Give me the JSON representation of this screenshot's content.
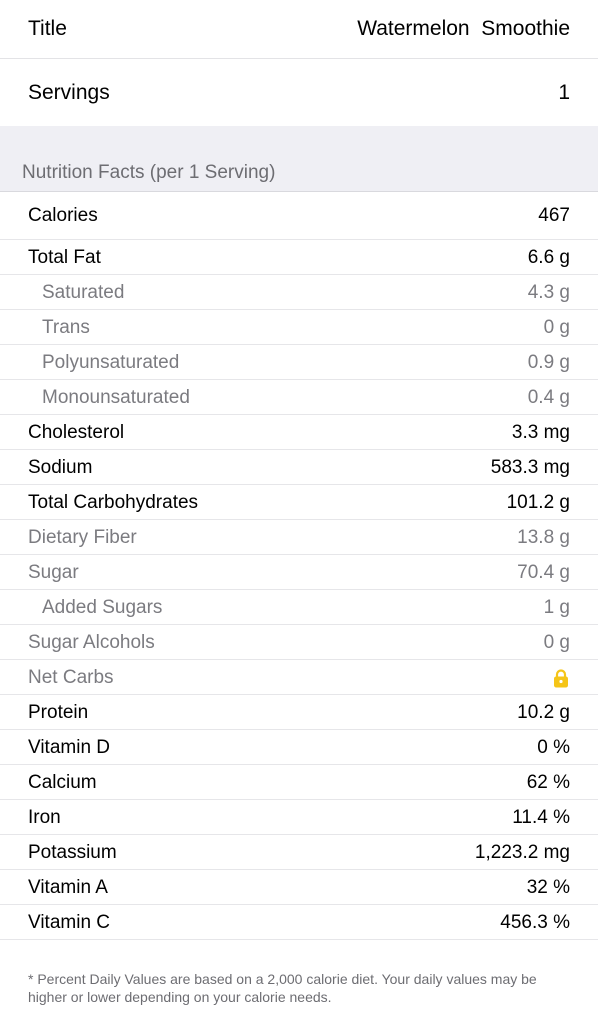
{
  "header": {
    "title_label": "Title",
    "title_value": "Watermelon  Smoothie",
    "servings_label": "Servings",
    "servings_value": "1"
  },
  "section": {
    "title": "Nutrition Facts (per 1 Serving)"
  },
  "facts": [
    {
      "label": "Calories",
      "value": "467"
    },
    {
      "label": "Total Fat",
      "value": "6.6 g"
    },
    {
      "label": "Saturated",
      "value": "4.3 g"
    },
    {
      "label": "Trans",
      "value": "0 g"
    },
    {
      "label": "Polyunsaturated",
      "value": "0.9 g"
    },
    {
      "label": "Monounsaturated",
      "value": "0.4 g"
    },
    {
      "label": "Cholesterol",
      "value": "3.3 mg"
    },
    {
      "label": "Sodium",
      "value": "583.3 mg"
    },
    {
      "label": "Total Carbohydrates",
      "value": "101.2 g"
    },
    {
      "label": "Dietary Fiber",
      "value": "13.8 g"
    },
    {
      "label": "Sugar",
      "value": "70.4 g"
    },
    {
      "label": "Added Sugars",
      "value": "1 g"
    },
    {
      "label": "Sugar Alcohols",
      "value": "0 g"
    },
    {
      "label": "Net Carbs",
      "icon": "lock-icon"
    },
    {
      "label": "Protein",
      "value": "10.2 g"
    },
    {
      "label": "Vitamin D",
      "value": "0 %"
    },
    {
      "label": "Calcium",
      "value": "62 %"
    },
    {
      "label": "Iron",
      "value": "11.4 %"
    },
    {
      "label": "Potassium",
      "value": "1,223.2 mg"
    },
    {
      "label": "Vitamin A",
      "value": "32 %"
    },
    {
      "label": "Vitamin C",
      "value": "456.3 %"
    }
  ],
  "footnote": "* Percent Daily Values are based on a 2,000 calorie diet.  Your daily values may be higher or lower depending on your calorie needs.",
  "colors": {
    "lock_accent": "#f5c518",
    "section_background": "#efeff4",
    "muted_text": "#7b7b80"
  }
}
